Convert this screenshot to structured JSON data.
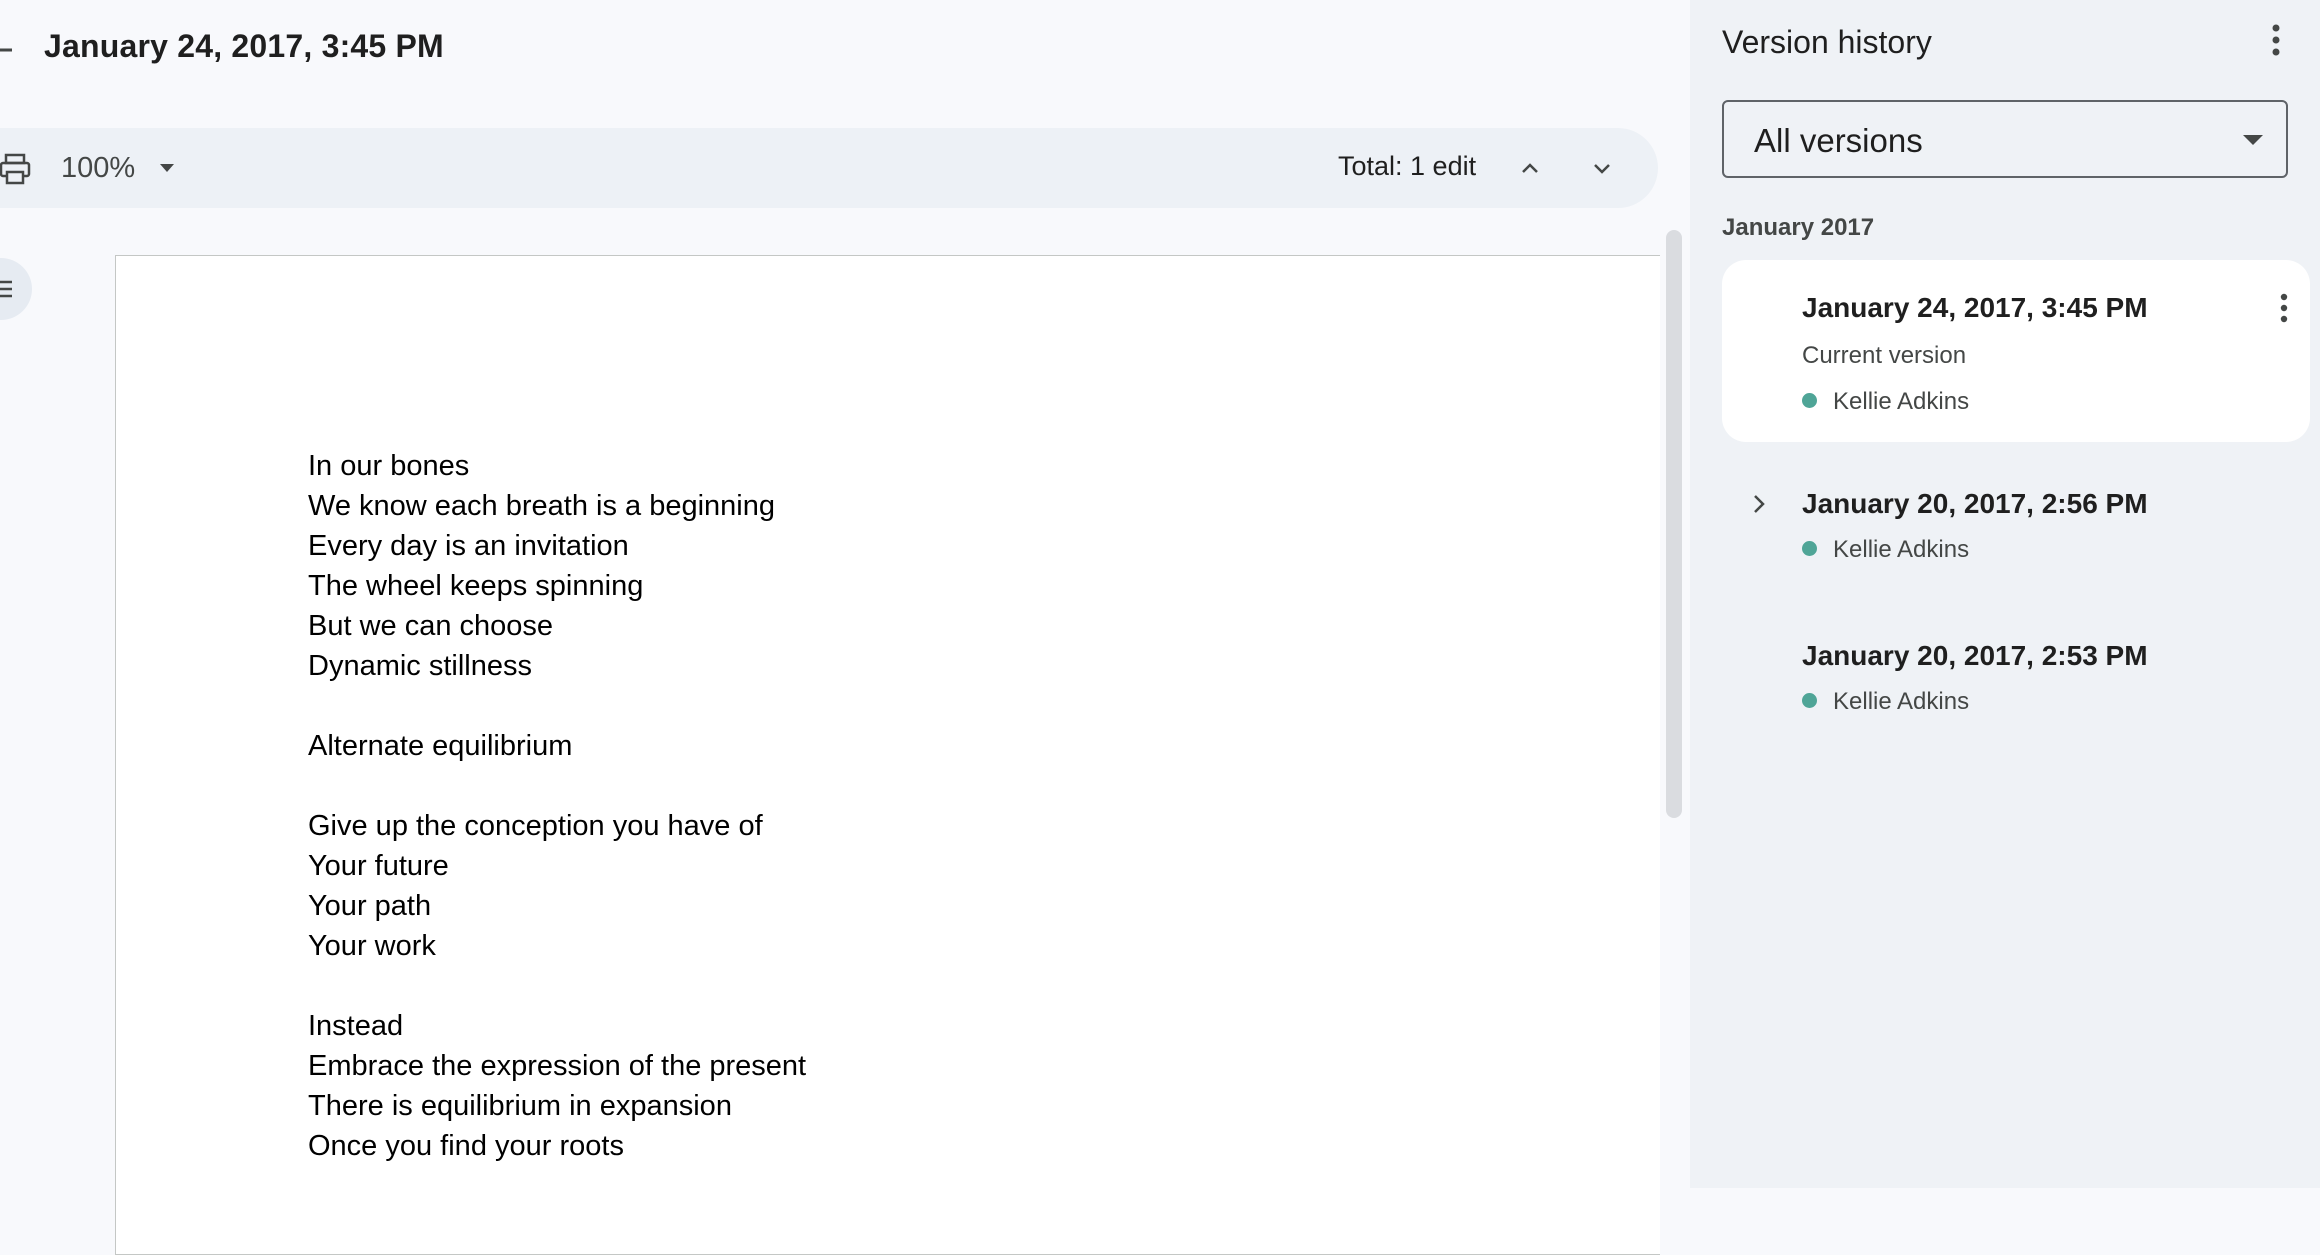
{
  "header": {
    "title": "January 24, 2017, 3:45 PM"
  },
  "toolbar": {
    "zoom": "100%",
    "total_edits": "Total: 1 edit"
  },
  "document": {
    "lines": [
      "In our bones",
      "We know each breath is a beginning",
      "Every day is an invitation",
      "The wheel keeps spinning",
      "But we can choose",
      "Dynamic stillness",
      "",
      "Alternate equilibrium",
      "",
      "Give up the conception you have of",
      "Your future",
      "Your path",
      "Your work",
      "",
      "Instead",
      "Embrace the expression of the present",
      "There is equilibrium in expansion",
      "Once you find your roots"
    ]
  },
  "sidebar": {
    "title": "Version history",
    "filter": "All versions",
    "month": "January 2017",
    "versions": [
      {
        "date": "January 24, 2017, 3:45 PM",
        "subtitle": "Current version",
        "author": "Kellie Adkins"
      },
      {
        "date": "January 20, 2017, 2:56 PM",
        "author": "Kellie Adkins"
      },
      {
        "date": "January 20, 2017, 2:53 PM",
        "author": "Kellie Adkins"
      }
    ]
  },
  "colors": {
    "author_dot": "#4fa597",
    "sidebar_bg": "#eff2f6",
    "toolbar_bg": "#edf1f6"
  },
  "icons": [
    "back-arrow-icon",
    "print-icon",
    "chevron-down-icon",
    "chevron-up-icon",
    "outline-icon",
    "more-vert-icon",
    "chevron-right-icon"
  ]
}
